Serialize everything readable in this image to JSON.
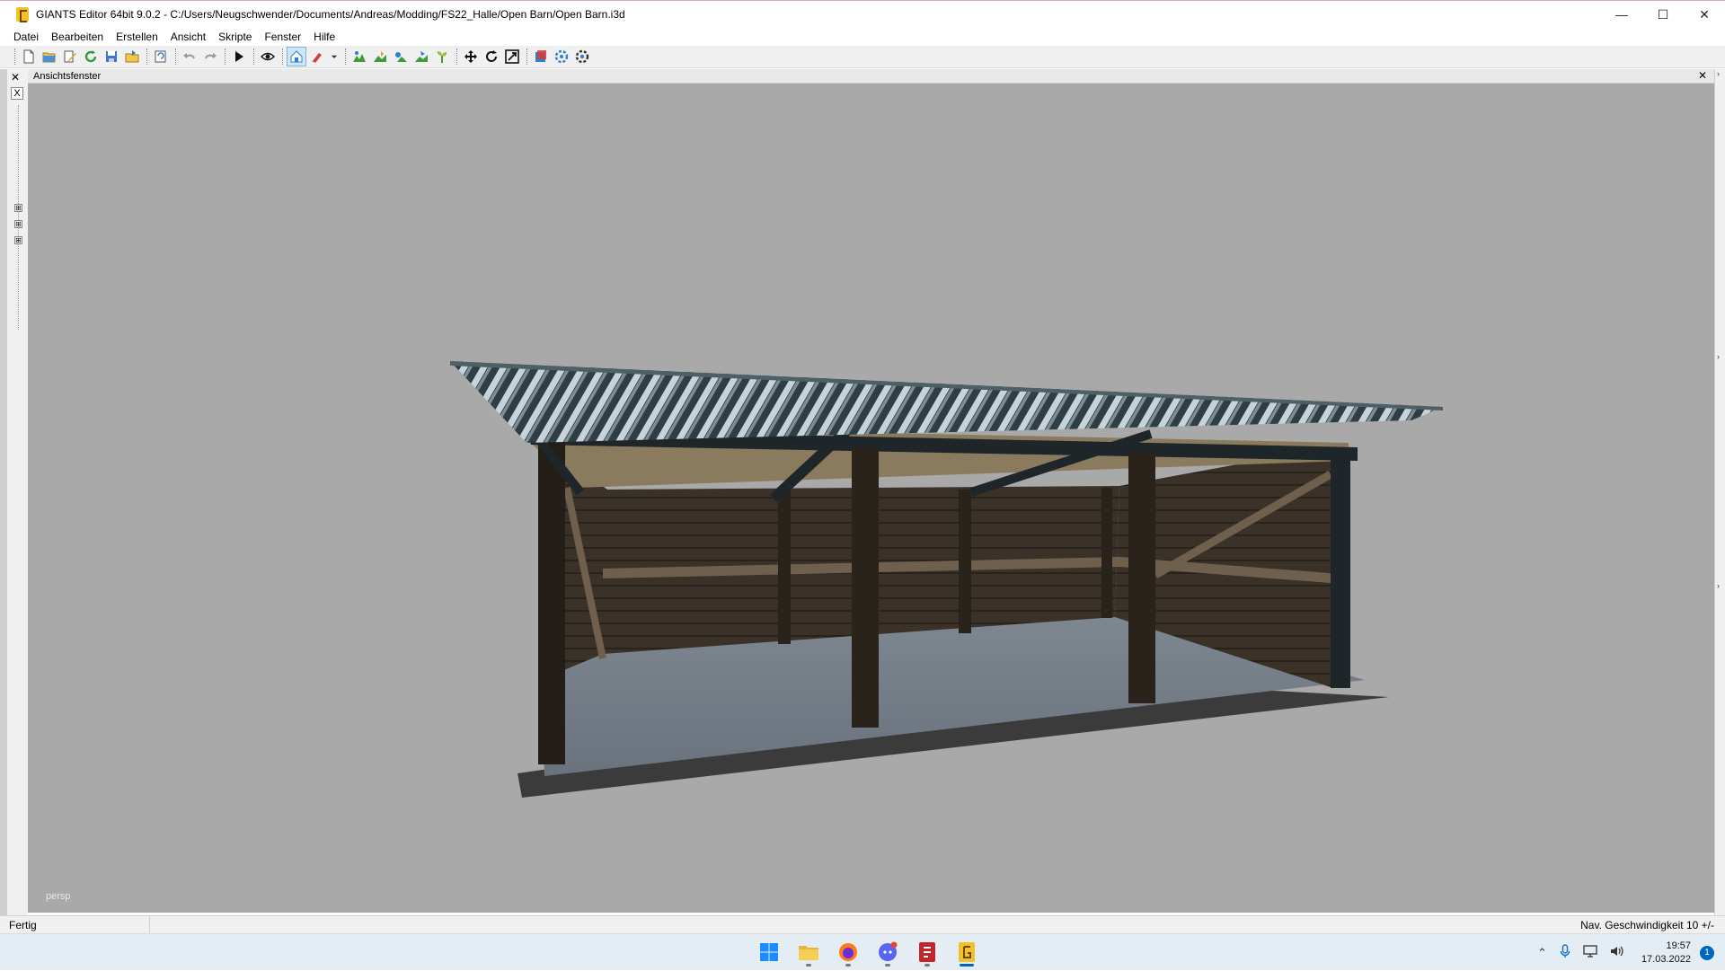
{
  "window": {
    "title": "GIANTS Editor 64bit 9.0.2 - C:/Users/Neugschwender/Documents/Andreas/Modding/FS22_Halle/Open Barn/Open Barn.i3d",
    "minimize": "—",
    "maximize": "☐",
    "close": "✕"
  },
  "menu": [
    "Datei",
    "Bearbeiten",
    "Erstellen",
    "Ansicht",
    "Skripte",
    "Fenster",
    "Hilfe"
  ],
  "toolbar": {
    "groups": [
      [
        "new-file-icon",
        "open-folder-icon",
        "edit-icon",
        "refresh-icon",
        "save-icon",
        "export-icon"
      ],
      [
        "history-icon"
      ],
      [
        "undo-icon",
        "redo-icon"
      ],
      [
        "play-icon"
      ],
      [
        "eye-icon"
      ],
      [
        "camera-icon",
        "brush-icon",
        "dropdown-arrow-icon"
      ],
      [
        "terrain-icon",
        "paint-icon",
        "foliage-icon",
        "sculpt-icon",
        "plant-icon"
      ],
      [
        "move-icon",
        "rotate-icon",
        "scale-icon"
      ],
      [
        "material-icon",
        "settings-icon",
        "gear-icon"
      ]
    ],
    "active": "camera-icon"
  },
  "left_dock": {
    "close": "✕",
    "x_button": "X",
    "tree_expanders": [
      "⊞",
      "⊞",
      "⊞"
    ]
  },
  "viewport": {
    "title": "Ansichtsfenster",
    "close": "✕",
    "camera_label": "persp",
    "background": "#a9a9a9"
  },
  "status": {
    "left": "Fertig",
    "right": "Nav. Geschwindigkeit 10 +/-"
  },
  "taskbar": {
    "apps": [
      "windows-start-icon",
      "file-explorer-icon",
      "firefox-icon",
      "discord-icon",
      "red-app-icon",
      "giants-editor-icon"
    ],
    "active_app": "giants-editor-icon",
    "time": "19:57",
    "date": "17.03.2022",
    "notification_count": "1",
    "tray": [
      "chevron-up-icon",
      "microphone-icon",
      "network-icon",
      "volume-icon"
    ]
  }
}
